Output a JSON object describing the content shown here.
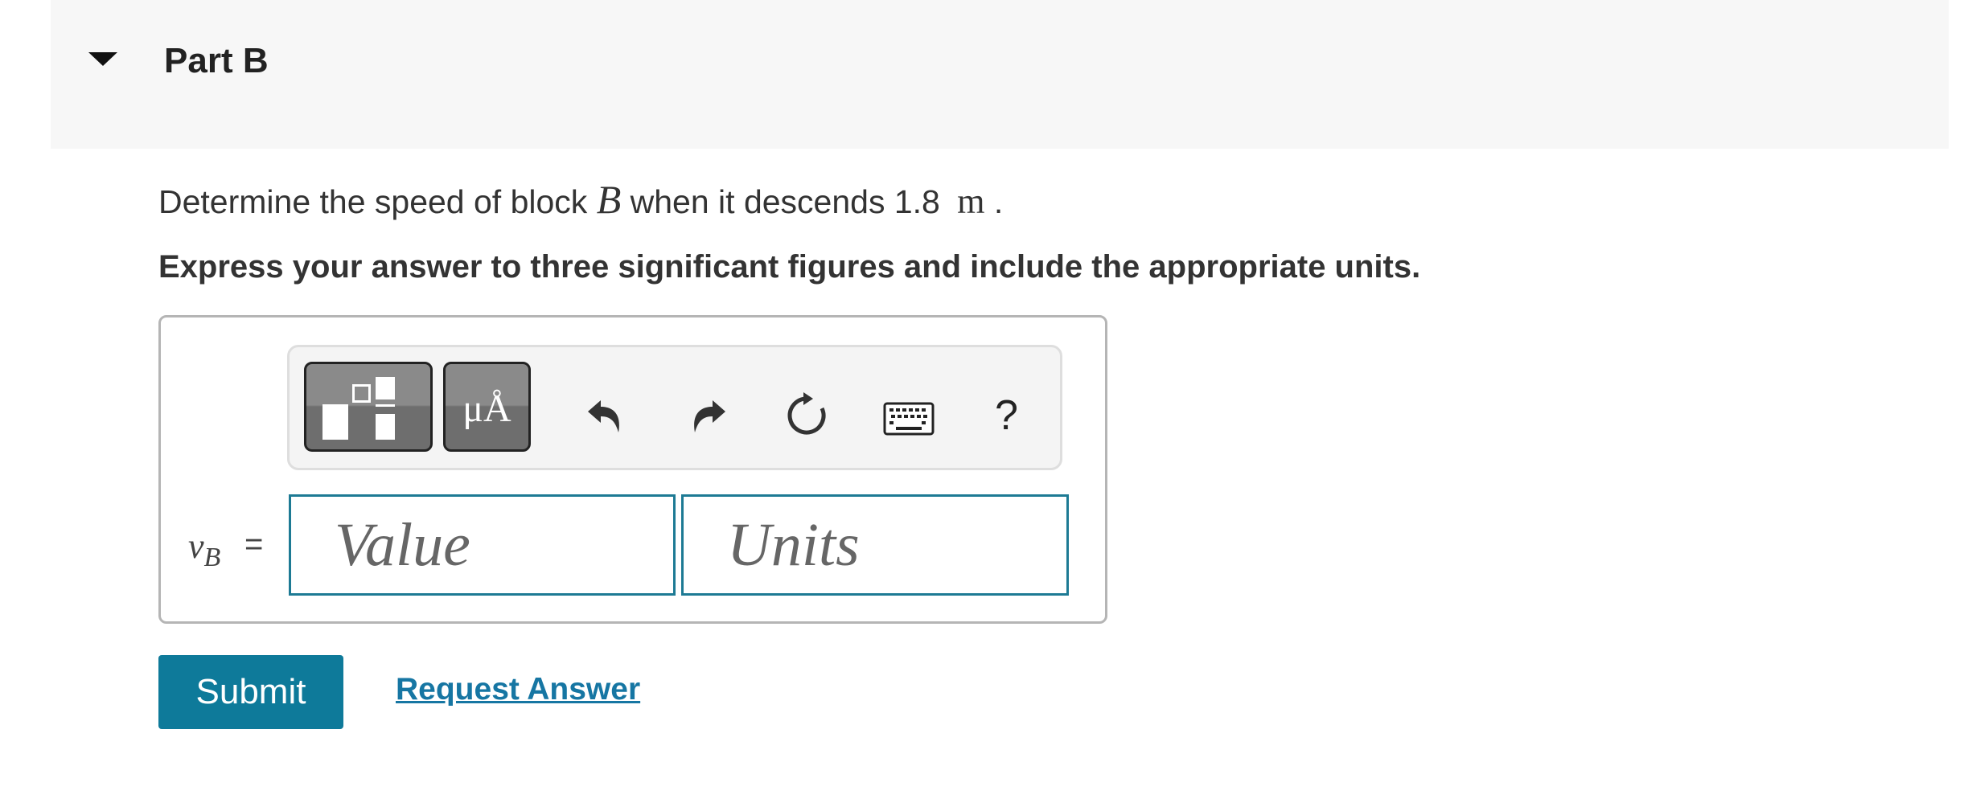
{
  "part": {
    "title": "Part B"
  },
  "question": {
    "text_before": "Determine the speed of block ",
    "variable": "B",
    "text_middle": " when it descends 1.8 ",
    "unit": "m",
    "text_after": " ."
  },
  "instruction": "Express your answer to three significant figures and include the appropriate units.",
  "toolbar": {
    "units_button_label": "μÅ",
    "help_label": "?",
    "icons": [
      "templates-icon",
      "units-icon",
      "undo-icon",
      "redo-icon",
      "reset-icon",
      "keyboard-icon",
      "help-icon"
    ]
  },
  "answer": {
    "variable": "v",
    "subscript": "B",
    "equals": "=",
    "value_placeholder": "Value",
    "units_placeholder": "Units"
  },
  "actions": {
    "submit_label": "Submit",
    "request_answer_label": "Request Answer"
  },
  "colors": {
    "accent": "#0e7a9a",
    "link": "#1676a3",
    "input_border": "#1d7a94",
    "header_bg": "#f7f7f7"
  }
}
